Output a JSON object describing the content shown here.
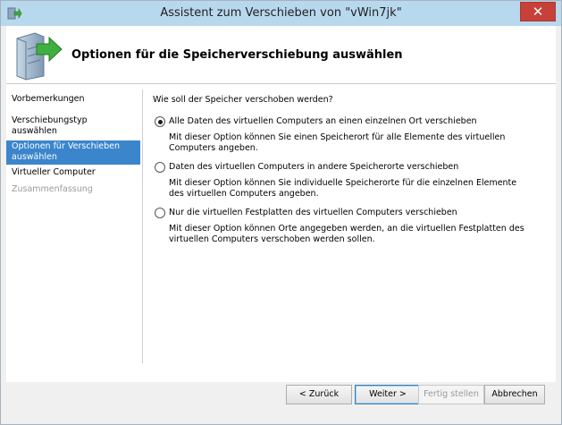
{
  "window": {
    "title": "Assistent zum Verschieben von \"vWin7jk\"",
    "close_label": "✕"
  },
  "header": {
    "title": "Optionen für die Speicherverschiebung auswählen"
  },
  "nav": {
    "items": [
      {
        "label": "Vorbemerkungen",
        "state": "normal"
      },
      {
        "label": "Verschiebungstyp auswählen",
        "state": "normal"
      },
      {
        "label": "Optionen für Verschieben auswählen",
        "state": "active"
      },
      {
        "label": "Virtueller Computer",
        "state": "normal"
      },
      {
        "label": "Zusammenfassung",
        "state": "disabled"
      }
    ]
  },
  "main": {
    "question": "Wie soll der Speicher verschoben werden?",
    "options": [
      {
        "label": "Alle Daten des virtuellen Computers an einen einzelnen Ort verschieben",
        "description": "Mit dieser Option können Sie einen Speicherort für alle Elemente des virtuellen Computers angeben.",
        "selected": true
      },
      {
        "label": "Daten des virtuellen Computers in andere Speicherorte verschieben",
        "description": "Mit dieser Option können Sie individuelle Speicherorte für die einzelnen Elemente des virtuellen Computers angeben.",
        "selected": false
      },
      {
        "label": "Nur die virtuellen Festplatten des virtuellen Computers verschieben",
        "description": "Mit dieser Option können Orte angegeben werden, an die virtuellen Festplatten des virtuellen Computers verschoben werden sollen.",
        "selected": false
      }
    ]
  },
  "footer": {
    "back_label": "< Zurück",
    "next_label": "Weiter >",
    "finish_label": "Fertig stellen",
    "cancel_label": "Abbrechen"
  },
  "colors": {
    "titlebar": "#b8d8ee",
    "nav_active": "#3b85cc",
    "close_button": "#c7403a"
  }
}
